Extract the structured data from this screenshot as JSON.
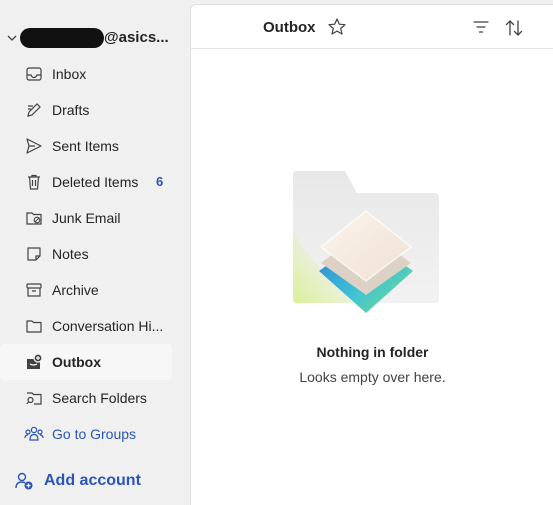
{
  "account": {
    "email_suffix": "@asics...",
    "chevron_icon": "chevron-down-icon"
  },
  "nav": {
    "items": [
      {
        "label": "Inbox",
        "icon": "inbox-icon"
      },
      {
        "label": "Drafts",
        "icon": "drafts-icon"
      },
      {
        "label": "Sent Items",
        "icon": "send-icon"
      },
      {
        "label": "Deleted Items",
        "icon": "trash-icon",
        "count": "6"
      },
      {
        "label": "Junk Email",
        "icon": "junk-folder-icon"
      },
      {
        "label": "Notes",
        "icon": "note-icon"
      },
      {
        "label": "Archive",
        "icon": "archive-icon"
      },
      {
        "label": "Conversation Hi...",
        "icon": "folder-icon"
      },
      {
        "label": "Outbox",
        "icon": "outbox-icon",
        "selected": true
      },
      {
        "label": "Search Folders",
        "icon": "search-folder-icon"
      },
      {
        "label": "Go to Groups",
        "icon": "groups-icon",
        "link": true
      }
    ]
  },
  "add_account": {
    "label": "Add account",
    "icon": "add-person-icon"
  },
  "header": {
    "title": "Outbox",
    "star_icon": "star-icon",
    "filter_icon": "filter-icon",
    "sort_icon": "sort-icon"
  },
  "empty_state": {
    "title": "Nothing in folder",
    "subtitle": "Looks empty over here."
  },
  "colors": {
    "accent": "#2b55b5",
    "sidebar_bg": "#f0f0f0",
    "selected_bg": "#f7f7f7",
    "pane_bg": "#ffffff"
  }
}
